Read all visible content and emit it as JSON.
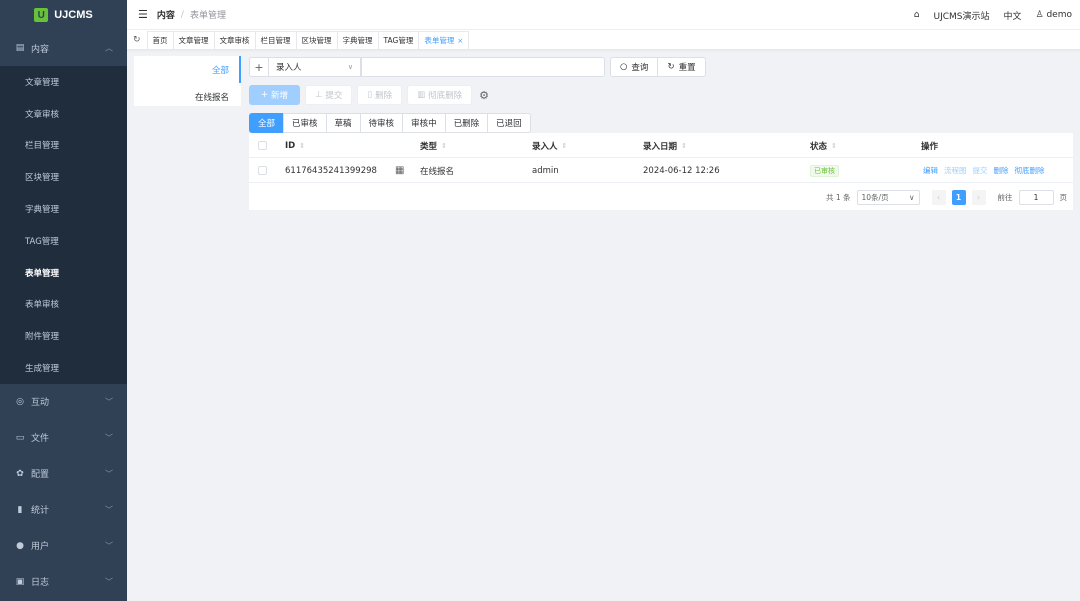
{
  "app": {
    "logo_mark": "U",
    "logo_text": "UJCMS"
  },
  "header": {
    "breadcrumb_root": "内容",
    "breadcrumb_sep": "/",
    "breadcrumb_current": "表单管理",
    "site_link": "UJCMS演示站",
    "language": "中文",
    "user": "demo"
  },
  "sidebar": {
    "groups": [
      {
        "label": "内容",
        "icon": "document-icon",
        "expanded": true
      },
      {
        "label": "互动",
        "icon": "chat-icon"
      },
      {
        "label": "文件",
        "icon": "folder-icon"
      },
      {
        "label": "配置",
        "icon": "gear-icon"
      },
      {
        "label": "统计",
        "icon": "bar-chart-icon"
      },
      {
        "label": "用户",
        "icon": "user-icon"
      },
      {
        "label": "日志",
        "icon": "clipboard-icon"
      }
    ],
    "content_items": [
      {
        "label": "文章管理"
      },
      {
        "label": "文章审核"
      },
      {
        "label": "栏目管理"
      },
      {
        "label": "区块管理"
      },
      {
        "label": "字典管理"
      },
      {
        "label": "TAG管理"
      },
      {
        "label": "表单管理",
        "active": true
      },
      {
        "label": "表单审核"
      },
      {
        "label": "附件管理"
      },
      {
        "label": "生成管理"
      }
    ]
  },
  "tags": [
    {
      "label": "首页"
    },
    {
      "label": "文章管理"
    },
    {
      "label": "文章审核"
    },
    {
      "label": "栏目管理"
    },
    {
      "label": "区块管理"
    },
    {
      "label": "字典管理"
    },
    {
      "label": "TAG管理"
    },
    {
      "label": "表单管理",
      "active": true,
      "close": "×"
    }
  ],
  "filter": {
    "items": [
      "全部",
      "在线报名"
    ]
  },
  "search": {
    "field": "录入人",
    "query_label": "查询",
    "reset_label": "重置"
  },
  "actions": {
    "add": "新增",
    "submit": "提交",
    "delete": "删除",
    "purge": "彻底删除"
  },
  "status_tabs": [
    "全部",
    "已审核",
    "草稿",
    "待审核",
    "审核中",
    "已删除",
    "已退回"
  ],
  "table": {
    "headers": {
      "id": "ID",
      "type": "类型",
      "creator": "录入人",
      "date": "录入日期",
      "status": "状态",
      "ops": "操作"
    },
    "rows": [
      {
        "id": "61176435241399298",
        "type": "在线报名",
        "creator": "admin",
        "date": "2024-06-12 12:26",
        "status": "已审核",
        "actions": [
          "编辑",
          "流程图",
          "提交",
          "删除",
          "彻底删除"
        ]
      }
    ]
  },
  "pagination": {
    "total": "共 1 条",
    "page_size": "10条/页",
    "current_page": "1",
    "goto_label": "前往",
    "goto_value": "1",
    "page_suffix": "页"
  },
  "colors": {
    "sidebar_bg": "#304156",
    "primary": "#409eff",
    "success": "#67c23a"
  }
}
